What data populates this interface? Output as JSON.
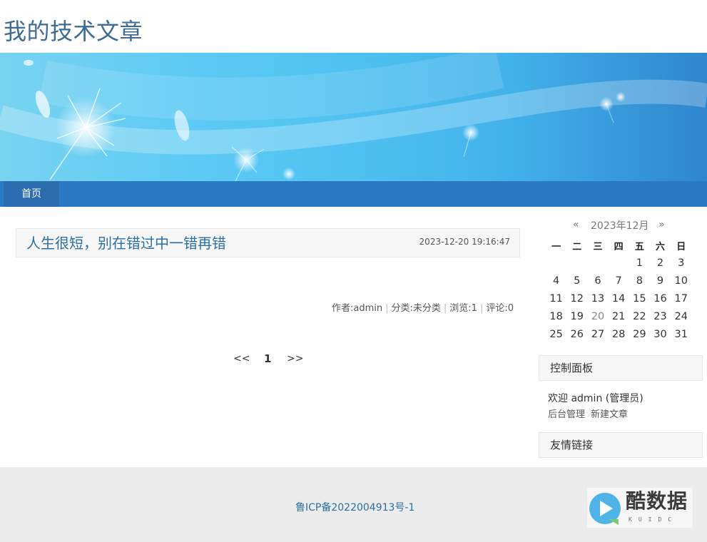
{
  "site": {
    "title": "我的技术文章"
  },
  "nav": {
    "items": [
      {
        "label": "首页"
      }
    ]
  },
  "post": {
    "title": "人生很短，别在错过中一错再错",
    "date": "2023-12-20 19:16:47",
    "meta": {
      "author": "作者:admin",
      "category": "分类:未分类",
      "views": "浏览:1",
      "comments": "评论:0",
      "separator": "|"
    }
  },
  "pagination": {
    "prev": "<<",
    "current": "1",
    "next": ">>"
  },
  "calendar": {
    "prev": "«",
    "month": "2023年12月",
    "next": "»",
    "weekdays": [
      "一",
      "二",
      "三",
      "四",
      "五",
      "六",
      "日"
    ],
    "weeks": [
      [
        "",
        "",
        "",
        "",
        "1",
        "2",
        "3"
      ],
      [
        "4",
        "5",
        "6",
        "7",
        "8",
        "9",
        "10"
      ],
      [
        "11",
        "12",
        "13",
        "14",
        "15",
        "16",
        "17"
      ],
      [
        "18",
        "19",
        "20",
        "21",
        "22",
        "23",
        "24"
      ],
      [
        "25",
        "26",
        "27",
        "28",
        "29",
        "30",
        "31"
      ]
    ],
    "today": "20"
  },
  "control_panel": {
    "title": "控制面板",
    "welcome": "欢迎 admin (管理员)",
    "links": [
      "后台管理",
      "新建文章"
    ]
  },
  "links_widget": {
    "title": "友情链接"
  },
  "footer": {
    "icp": "鲁ICP备2022004913号-1"
  },
  "watermark": {
    "text": "酷数据",
    "sub": "KUIDC"
  },
  "colors": {
    "title": "#3d6b93",
    "nav_bar": "#2b78c3",
    "nav_active": "#2b6dae",
    "link": "#2b6fa6",
    "footer_bg": "#ececec"
  }
}
